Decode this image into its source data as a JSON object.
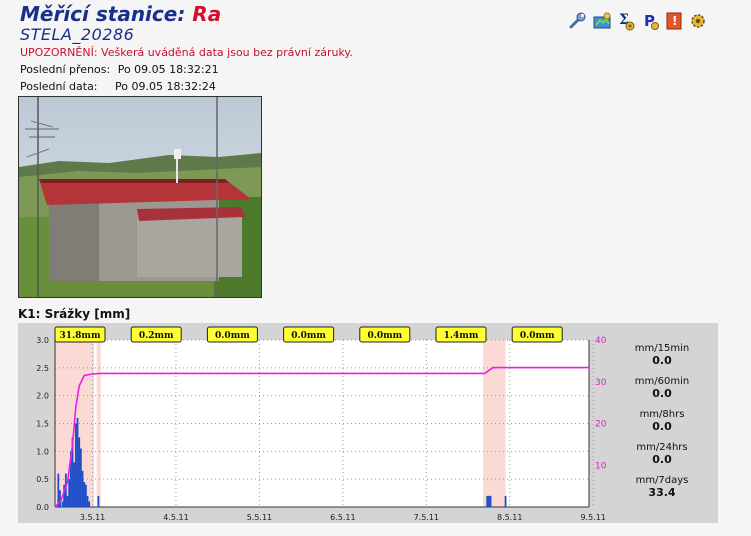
{
  "header": {
    "title_prefix": "Měřící stanice: ",
    "title_name": "Ra",
    "station_id": "STELA_20286",
    "warning": "UPOZORNĚNÍ: Veškerá uváděná data jsou bez právní záruky.",
    "last_transfer_label": "Poslední přenos:",
    "last_transfer_value": "Po 09.05 18:32:21",
    "last_data_label": "Poslední data:",
    "last_data_value": "Po 09.05 18:32:24"
  },
  "toolbar": {
    "icons": [
      "wrench-icon",
      "map-icon",
      "sum-icon",
      "parking-icon",
      "pdf-icon",
      "settings-icon"
    ]
  },
  "photo": {
    "description_icon": "station-photo"
  },
  "section": {
    "label": "K1: Srážky [mm]"
  },
  "stats": [
    {
      "label": "mm/15min",
      "value": "0.0"
    },
    {
      "label": "mm/60min",
      "value": "0.0"
    },
    {
      "label": "mm/8hrs",
      "value": "0.0"
    },
    {
      "label": "mm/24hrs",
      "value": "0.0"
    },
    {
      "label": "mm/7days",
      "value": "33.4"
    }
  ],
  "chart_data": {
    "type": "bar",
    "x_ticks": [
      "3.5.11",
      "4.5.11",
      "5.5.11",
      "6.5.11",
      "7.5.11",
      "8.5.11",
      "9.5.11"
    ],
    "x_range_days": [
      2.55,
      8.95
    ],
    "y_left_ticks": [
      "0.0",
      "0.5",
      "1.0",
      "1.5",
      "2.0",
      "2.5",
      "3.0"
    ],
    "y_left_range": [
      0,
      3.0
    ],
    "y_right_ticks": [
      "10",
      "20",
      "30",
      "40"
    ],
    "y_right_range": [
      0,
      40
    ],
    "daily_totals": [
      "31.8mm",
      "0.2mm",
      "0.0mm",
      "0.0mm",
      "0.0mm",
      "1.4mm",
      "0.0mm"
    ],
    "rain_bars": {
      "name": "precipitation intensity",
      "color": "#1f4fc8",
      "points": [
        [
          2.59,
          0.6
        ],
        [
          2.61,
          0.3
        ],
        [
          2.64,
          0.1
        ],
        [
          2.66,
          0.4
        ],
        [
          2.68,
          0.6
        ],
        [
          2.7,
          0.2
        ],
        [
          2.72,
          0.5
        ],
        [
          2.74,
          1.0
        ],
        [
          2.76,
          1.25
        ],
        [
          2.78,
          0.8
        ],
        [
          2.8,
          1.5
        ],
        [
          2.82,
          1.6
        ],
        [
          2.84,
          1.25
        ],
        [
          2.86,
          1.05
        ],
        [
          2.88,
          0.65
        ],
        [
          2.9,
          0.45
        ],
        [
          2.92,
          0.4
        ],
        [
          2.94,
          0.2
        ],
        [
          2.96,
          0.1
        ],
        [
          3.07,
          0.2
        ],
        [
          7.73,
          0.2
        ],
        [
          7.75,
          0.2
        ],
        [
          7.77,
          0.2
        ],
        [
          7.95,
          0.2
        ]
      ]
    },
    "cumulative_line": {
      "name": "cumulative precipitation",
      "color": "#ee1ee6",
      "points": [
        [
          2.55,
          0
        ],
        [
          2.62,
          1.5
        ],
        [
          2.7,
          6
        ],
        [
          2.76,
          15
        ],
        [
          2.8,
          24
        ],
        [
          2.84,
          29
        ],
        [
          2.9,
          31.5
        ],
        [
          2.98,
          31.8
        ],
        [
          3.08,
          32.0
        ],
        [
          7.7,
          32.0
        ],
        [
          7.8,
          33.4
        ],
        [
          8.95,
          33.4
        ]
      ]
    },
    "highlight_spans": [
      [
        2.55,
        3.02
      ],
      [
        3.05,
        3.1
      ],
      [
        7.68,
        7.95
      ]
    ],
    "highlight_color": "#fbd9d5",
    "grid": "dotted"
  }
}
